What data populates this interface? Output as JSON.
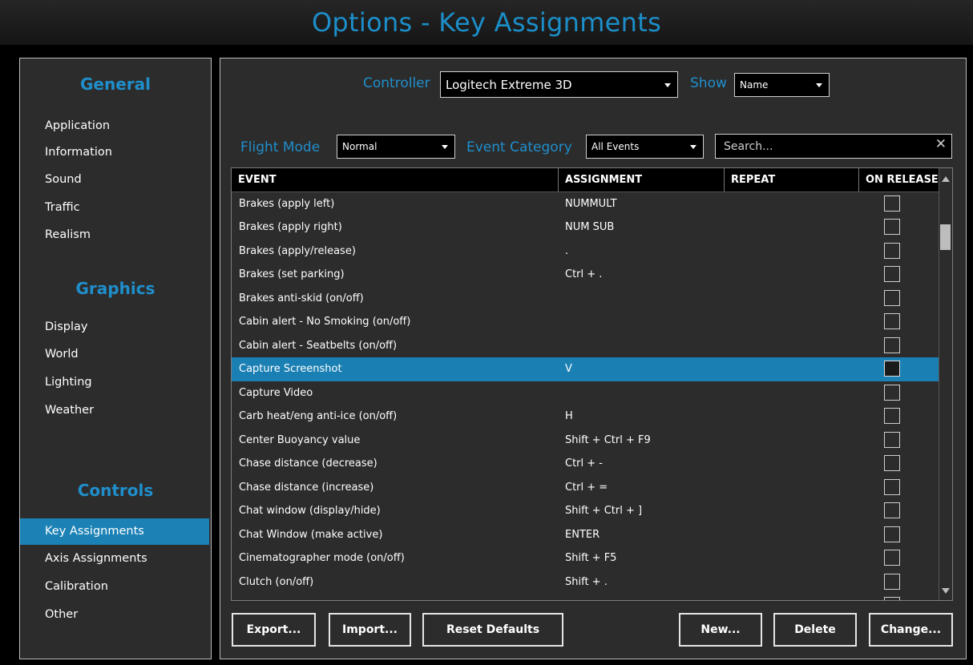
{
  "window": {
    "title": "Options - Key Assignments"
  },
  "sidebar": {
    "general_heading": "General",
    "general_items": [
      "Application",
      "Information",
      "Sound",
      "Traffic",
      "Realism"
    ],
    "graphics_heading": "Graphics",
    "graphics_items": [
      "Display",
      "World",
      "Lighting",
      "Weather"
    ],
    "controls_heading": "Controls",
    "controls_items": [
      "Key Assignments",
      "Axis Assignments",
      "Calibration",
      "Other"
    ],
    "active_item": "Key Assignments"
  },
  "filters": {
    "controller_label": "Controller",
    "controller_value": "Logitech Extreme 3D",
    "show_label": "Show",
    "show_value": "Name",
    "flight_mode_label": "Flight Mode",
    "flight_mode_value": "Normal",
    "event_category_label": "Event Category",
    "event_category_value": "All Events",
    "search_placeholder": "Search...",
    "clear_icon": "close-icon"
  },
  "table": {
    "headers": [
      "EVENT",
      "ASSIGNMENT",
      "REPEAT",
      "ON RELEASE"
    ],
    "rows": [
      {
        "event": "Brakes (apply left)",
        "assignment": "NUMMULT"
      },
      {
        "event": "Brakes (apply right)",
        "assignment": "NUM SUB"
      },
      {
        "event": "Brakes (apply/release)",
        "assignment": "."
      },
      {
        "event": "Brakes (set parking)",
        "assignment": "Ctrl + ."
      },
      {
        "event": "Brakes anti-skid (on/off)",
        "assignment": ""
      },
      {
        "event": "Cabin alert - No Smoking (on/off)",
        "assignment": ""
      },
      {
        "event": "Cabin alert - Seatbelts (on/off)",
        "assignment": ""
      },
      {
        "event": "Capture Screenshot",
        "assignment": "V",
        "selected": true
      },
      {
        "event": "Capture Video",
        "assignment": ""
      },
      {
        "event": "Carb heat/eng anti-ice (on/off)",
        "assignment": "H"
      },
      {
        "event": "Center Buoyancy value",
        "assignment": "Shift + Ctrl + F9"
      },
      {
        "event": "Chase distance (decrease)",
        "assignment": "Ctrl + -"
      },
      {
        "event": "Chase distance (increase)",
        "assignment": "Ctrl + ="
      },
      {
        "event": "Chat window (display/hide)",
        "assignment": "Shift + Ctrl + ]"
      },
      {
        "event": "Chat Window (make active)",
        "assignment": "ENTER"
      },
      {
        "event": "Cinematographer mode (on/off)",
        "assignment": "Shift + F5"
      },
      {
        "event": "Clutch (on/off)",
        "assignment": "Shift + ."
      }
    ]
  },
  "buttons": {
    "export": "Export...",
    "import": "Import...",
    "reset_defaults": "Reset Defaults",
    "new": "New...",
    "delete": "Delete",
    "change": "Change..."
  },
  "colors": {
    "accent": "#1f8fcc",
    "selected_row": "#1a7fb3",
    "panel_bg": "#2c2c2c"
  }
}
